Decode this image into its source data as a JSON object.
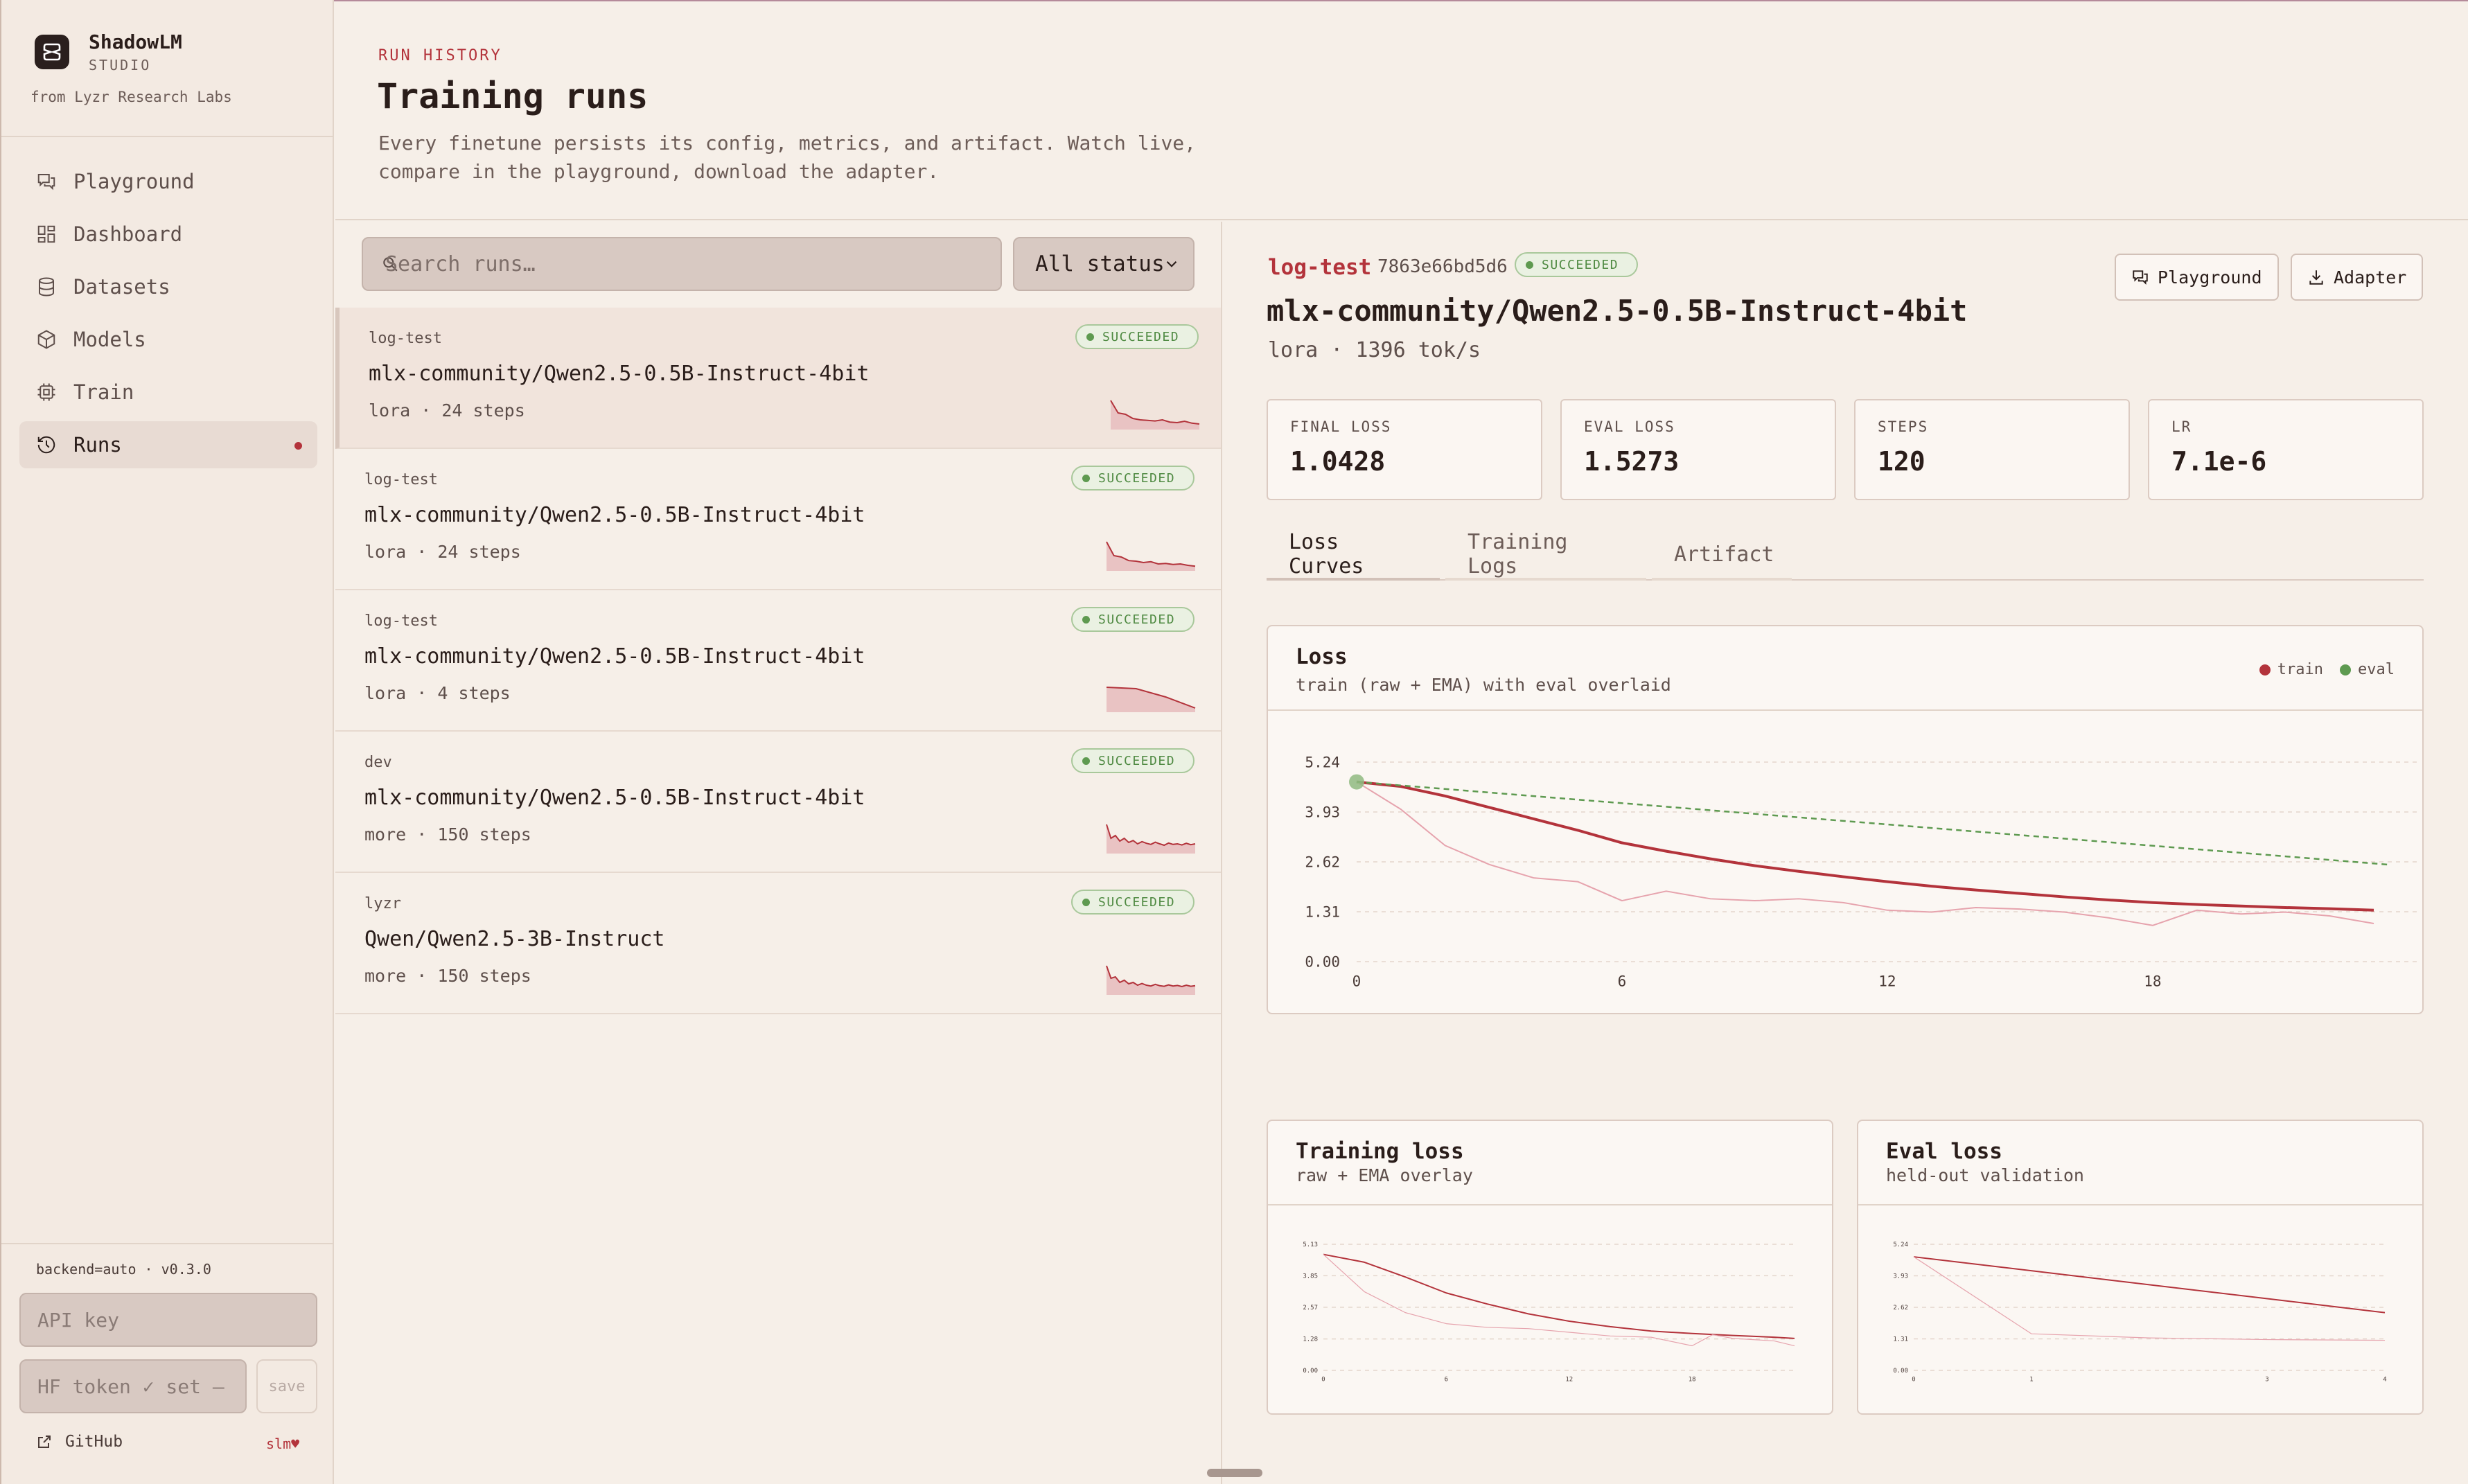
{
  "app": {
    "name": "ShadowLM",
    "subtitle": "STUDIO",
    "from": "from Lyzr Research Labs"
  },
  "nav": [
    {
      "label": "Playground",
      "icon": "chat-icon",
      "active": false
    },
    {
      "label": "Dashboard",
      "icon": "grid-icon",
      "active": false
    },
    {
      "label": "Datasets",
      "icon": "database-icon",
      "active": false
    },
    {
      "label": "Models",
      "icon": "cube-icon",
      "active": false
    },
    {
      "label": "Train",
      "icon": "chip-icon",
      "active": false
    },
    {
      "label": "Runs",
      "icon": "history-icon",
      "active": true
    }
  ],
  "sidebar_footer": {
    "meta": "backend=auto · v0.3.0",
    "api_key_placeholder": "API key",
    "hf_token_value": "HF token ✓ set —",
    "save_label": "save",
    "github_label": "GitHub",
    "slm_label": "slm♥"
  },
  "header": {
    "eyebrow": "RUN HISTORY",
    "title": "Training runs",
    "description": "Every finetune persists its config, metrics, and artifact. Watch live, compare in the playground, download the adapter."
  },
  "list": {
    "search_placeholder": "Search runs…",
    "status_filter": "All status",
    "runs": [
      {
        "tag": "log-test",
        "status": "SUCCEEDED",
        "model": "mlx-community/Qwen2.5-0.5B-Instruct-4bit",
        "meta": "lora · 24 steps",
        "spark": [
          1.0,
          0.55,
          0.5,
          0.35,
          0.3,
          0.28,
          0.26,
          0.3,
          0.22,
          0.2,
          0.25,
          0.18,
          0.15
        ]
      },
      {
        "tag": "log-test",
        "status": "SUCCEEDED",
        "model": "mlx-community/Qwen2.5-0.5B-Instruct-4bit",
        "meta": "lora · 24 steps",
        "spark": [
          1.0,
          0.5,
          0.45,
          0.32,
          0.3,
          0.25,
          0.28,
          0.2,
          0.22,
          0.18,
          0.2,
          0.15,
          0.12
        ]
      },
      {
        "tag": "log-test",
        "status": "SUCCEEDED",
        "model": "mlx-community/Qwen2.5-0.5B-Instruct-4bit",
        "meta": "lora · 4 steps",
        "spark": [
          0.85,
          0.8,
          0.5,
          0.1
        ]
      },
      {
        "tag": "dev",
        "status": "SUCCEEDED",
        "model": "mlx-community/Qwen2.5-0.5B-Instruct-4bit",
        "meta": "more · 150 steps",
        "spark": [
          1.0,
          0.5,
          0.6,
          0.4,
          0.5,
          0.35,
          0.42,
          0.3,
          0.38,
          0.32,
          0.28,
          0.36,
          0.3,
          0.25,
          0.33,
          0.28,
          0.3,
          0.26,
          0.32,
          0.27,
          0.3
        ]
      },
      {
        "tag": "lyzr",
        "status": "SUCCEEDED",
        "model": "Qwen/Qwen2.5-3B-Instruct",
        "meta": "more · 150 steps",
        "spark": [
          1.0,
          0.55,
          0.6,
          0.4,
          0.48,
          0.35,
          0.4,
          0.3,
          0.36,
          0.3,
          0.27,
          0.33,
          0.28,
          0.26,
          0.31,
          0.27,
          0.29,
          0.25,
          0.3,
          0.26,
          0.28
        ]
      }
    ]
  },
  "detail": {
    "tag": "log-test",
    "hash": "7863e66bd5d6",
    "status": "SUCCEEDED",
    "model": "mlx-community/Qwen2.5-0.5B-Instruct-4bit",
    "subline": "lora · 1396 tok/s",
    "buttons": {
      "playground": "Playground",
      "adapter": "Adapter"
    },
    "stats": [
      {
        "label": "FINAL LOSS",
        "value": "1.0428"
      },
      {
        "label": "EVAL LOSS",
        "value": "1.5273"
      },
      {
        "label": "STEPS",
        "value": "120"
      },
      {
        "label": "LR",
        "value": "7.1e-6"
      }
    ],
    "tabs": [
      "Loss Curves",
      "Training Logs",
      "Artifact"
    ],
    "active_tab": 0,
    "loss_card": {
      "title": "Loss",
      "subtitle": "train (raw + EMA) with eval overlaid",
      "legend_train": "train",
      "legend_eval": "eval"
    },
    "train_card": {
      "title": "Training loss",
      "subtitle": "raw + EMA overlay"
    },
    "eval_card": {
      "title": "Eval loss",
      "subtitle": "held-out validation"
    }
  },
  "colors": {
    "accent": "#b3333b",
    "eval": "#5e9a50",
    "raw": "#e6a3ad",
    "badge": "#4f8a42"
  },
  "chart_data": [
    {
      "type": "line",
      "title": "Loss",
      "xlim": [
        0,
        23
      ],
      "ylim": [
        0,
        5.24
      ],
      "yticks": [
        "0.00",
        "1.31",
        "2.62",
        "3.93",
        "5.24"
      ],
      "xticks": [
        "0",
        "6",
        "12",
        "18"
      ],
      "grid": true,
      "legend": "top-right",
      "series": [
        {
          "name": "train",
          "style": "EMA",
          "x": [
            0,
            1,
            2,
            3,
            4,
            5,
            6,
            7,
            8,
            9,
            10,
            11,
            12,
            13,
            14,
            15,
            16,
            17,
            18,
            19,
            20,
            21,
            22,
            23
          ],
          "values": [
            4.72,
            4.6,
            4.35,
            4.05,
            3.75,
            3.45,
            3.12,
            2.9,
            2.7,
            2.52,
            2.37,
            2.23,
            2.1,
            1.98,
            1.88,
            1.79,
            1.7,
            1.62,
            1.55,
            1.5,
            1.46,
            1.42,
            1.39,
            1.35
          ]
        },
        {
          "style": "raw",
          "x": [
            0,
            1,
            2,
            3,
            4,
            5,
            6,
            7,
            8,
            9,
            10,
            11,
            12,
            13,
            14,
            15,
            16,
            17,
            18,
            19,
            20,
            21,
            22,
            23
          ],
          "values": [
            4.72,
            4.0,
            3.05,
            2.55,
            2.2,
            2.1,
            1.6,
            1.85,
            1.65,
            1.6,
            1.65,
            1.55,
            1.35,
            1.3,
            1.42,
            1.38,
            1.3,
            1.15,
            0.95,
            1.35,
            1.25,
            1.3,
            1.2,
            1.0
          ]
        },
        {
          "name": "eval",
          "x": [
            0,
            23.3
          ],
          "values": [
            4.72,
            2.55
          ]
        }
      ]
    },
    {
      "type": "line",
      "title": "Training loss",
      "xlim": [
        0,
        23
      ],
      "ylim": [
        0,
        5.13
      ],
      "yticks": [
        "0.00",
        "1.28",
        "2.57",
        "3.85",
        "5.13"
      ],
      "xticks": [
        "0",
        "6",
        "12",
        "18"
      ],
      "series": [
        {
          "style": "EMA",
          "x": [
            0,
            2,
            4,
            6,
            8,
            10,
            12,
            14,
            16,
            18,
            20,
            22,
            23
          ],
          "values": [
            4.72,
            4.4,
            3.8,
            3.15,
            2.7,
            2.3,
            2.0,
            1.78,
            1.6,
            1.5,
            1.42,
            1.35,
            1.3
          ]
        },
        {
          "style": "raw",
          "x": [
            0,
            2,
            4,
            6,
            8,
            10,
            12,
            14,
            16,
            18,
            19,
            20,
            22,
            23
          ],
          "values": [
            4.72,
            3.2,
            2.35,
            1.9,
            1.75,
            1.7,
            1.55,
            1.4,
            1.35,
            1.0,
            1.45,
            1.3,
            1.2,
            1.0
          ]
        }
      ]
    },
    {
      "type": "line",
      "title": "Eval loss",
      "xlim": [
        0,
        4
      ],
      "ylim": [
        0,
        5.24
      ],
      "yticks": [
        "0.00",
        "1.31",
        "2.62",
        "3.93",
        "5.24"
      ],
      "xticks": [
        "0",
        "1",
        "3",
        "4"
      ],
      "series": [
        {
          "x": [
            0,
            4
          ],
          "values": [
            4.72,
            2.4
          ]
        },
        {
          "style": "raw",
          "x": [
            0,
            1,
            2,
            3,
            4
          ],
          "values": [
            4.72,
            1.52,
            1.35,
            1.28,
            1.25
          ]
        }
      ]
    }
  ]
}
